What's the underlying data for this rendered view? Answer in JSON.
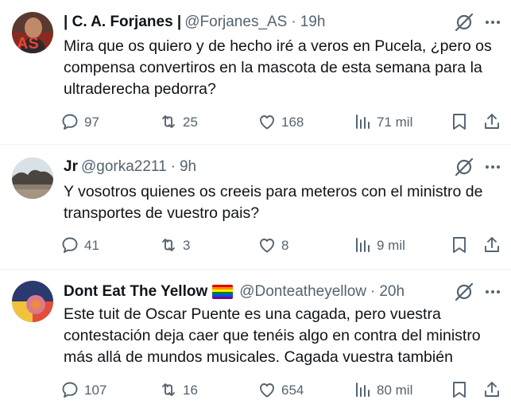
{
  "tweets": [
    {
      "name": "| C. A. Forjanes |",
      "handle": "@Forjanes_AS",
      "time": "19h",
      "text": "Mira que os quiero y de hecho iré a veros en Pucela, ¿pero os compensa convertiros en la mascota de esta semana para la ultraderecha pedorra?",
      "replies": "97",
      "retweets": "25",
      "likes": "168",
      "views": "71 mil"
    },
    {
      "name": "Jr",
      "handle": "@gorka2211",
      "time": "9h",
      "text": "Y vosotros quienes os creeis para meteros con el ministro de transportes de vuestro pais?",
      "replies": "41",
      "retweets": "3",
      "likes": "8",
      "views": "9 mil"
    },
    {
      "name": "Dont Eat The Yellow",
      "handle": "@Donteatheyellow",
      "time": "20h",
      "text": "Este tuit de Oscar Puente es una cagada, pero vuestra contestación deja caer que tenéis algo en contra del ministro más allá de mundos musicales. Cagada vuestra también",
      "replies": "107",
      "retweets": "16",
      "likes": "654",
      "views": "80 mil"
    }
  ],
  "separator": "·",
  "icons": {
    "reply": "reply-icon",
    "retweet": "retweet-icon",
    "like": "heart-icon",
    "views": "views-chart-icon",
    "bookmark": "bookmark-icon",
    "share": "share-icon",
    "grok": "grok-icon",
    "more": "more-options-icon",
    "flag": "rainbow-flag-emoji"
  },
  "colors": {
    "text": "#0f1419",
    "secondary": "#536471",
    "divider": "#eff3f4",
    "background": "#ffffff"
  }
}
